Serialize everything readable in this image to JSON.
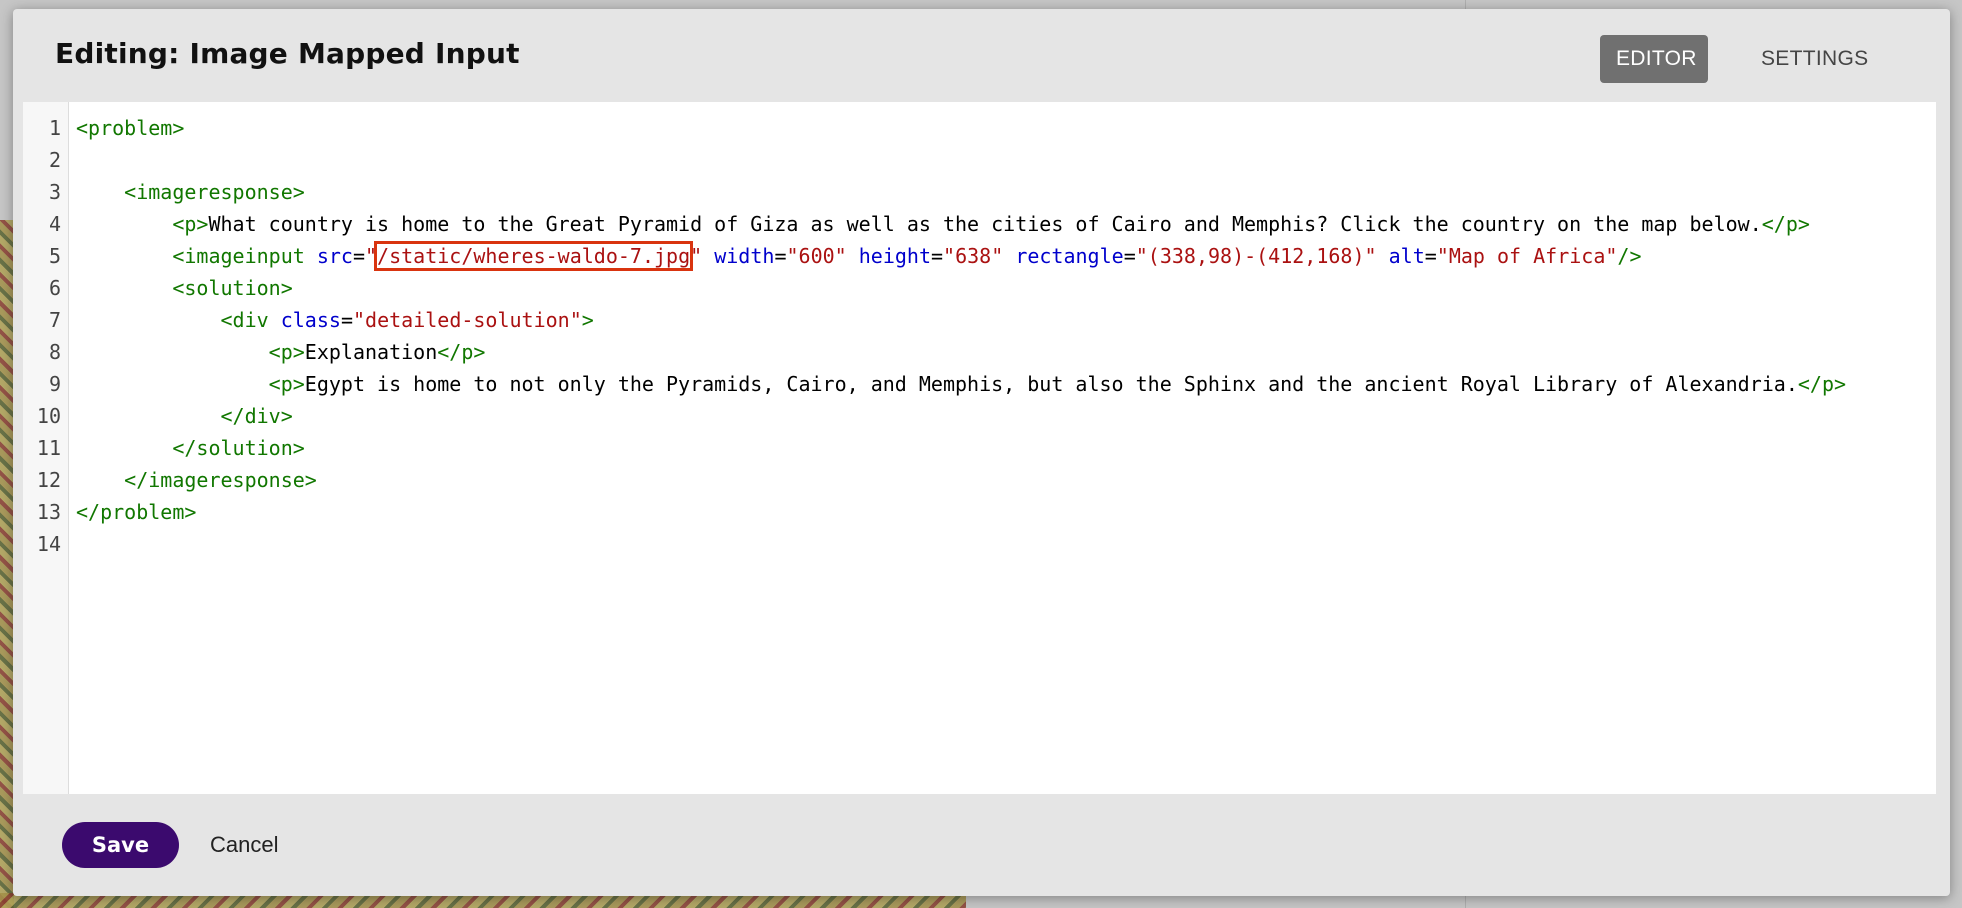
{
  "modal": {
    "title": "Editing: Image Mapped Input",
    "tabs": [
      {
        "label": "EDITOR",
        "active": true
      },
      {
        "label": "SETTINGS",
        "active": false
      }
    ]
  },
  "editor": {
    "highlight_color": "#d9340f",
    "lines": [
      {
        "num": "1",
        "segments": [
          {
            "t": "tag",
            "v": "<problem>"
          }
        ]
      },
      {
        "num": "2",
        "segments": []
      },
      {
        "num": "3",
        "segments": [
          {
            "t": "text",
            "v": "    "
          },
          {
            "t": "tag",
            "v": "<imageresponse>"
          }
        ]
      },
      {
        "num": "4",
        "segments": [
          {
            "t": "text",
            "v": "        "
          },
          {
            "t": "tag",
            "v": "<p>"
          },
          {
            "t": "text",
            "v": "What country is home to the Great Pyramid of Giza as well as the cities of Cairo and Memphis? Click the country on the map below."
          },
          {
            "t": "tag",
            "v": "</p>"
          }
        ]
      },
      {
        "num": "5",
        "segments": [
          {
            "t": "text",
            "v": "        "
          },
          {
            "t": "tag",
            "v": "<imageinput "
          },
          {
            "t": "attr",
            "v": "src"
          },
          {
            "t": "text",
            "v": "="
          },
          {
            "t": "str",
            "v": "\""
          },
          {
            "t": "str_hl",
            "v": "/static/wheres-waldo-7.jpg"
          },
          {
            "t": "str",
            "v": "\""
          },
          {
            "t": "text",
            "v": " "
          },
          {
            "t": "attr",
            "v": "width"
          },
          {
            "t": "text",
            "v": "="
          },
          {
            "t": "str",
            "v": "\"600\""
          },
          {
            "t": "text",
            "v": " "
          },
          {
            "t": "attr",
            "v": "height"
          },
          {
            "t": "text",
            "v": "="
          },
          {
            "t": "str",
            "v": "\"638\""
          },
          {
            "t": "text",
            "v": " "
          },
          {
            "t": "attr",
            "v": "rectangle"
          },
          {
            "t": "text",
            "v": "="
          },
          {
            "t": "str",
            "v": "\"(338,98)-(412,168)\""
          },
          {
            "t": "text",
            "v": " "
          },
          {
            "t": "attr",
            "v": "alt"
          },
          {
            "t": "text",
            "v": "="
          },
          {
            "t": "str",
            "v": "\"Map of Africa\""
          },
          {
            "t": "tag",
            "v": "/>"
          }
        ]
      },
      {
        "num": "6",
        "segments": [
          {
            "t": "text",
            "v": "        "
          },
          {
            "t": "tag",
            "v": "<solution>"
          }
        ]
      },
      {
        "num": "7",
        "segments": [
          {
            "t": "text",
            "v": "            "
          },
          {
            "t": "tag",
            "v": "<div "
          },
          {
            "t": "attr",
            "v": "class"
          },
          {
            "t": "text",
            "v": "="
          },
          {
            "t": "str",
            "v": "\"detailed-solution\""
          },
          {
            "t": "tag",
            "v": ">"
          }
        ]
      },
      {
        "num": "8",
        "segments": [
          {
            "t": "text",
            "v": "                "
          },
          {
            "t": "tag",
            "v": "<p>"
          },
          {
            "t": "text",
            "v": "Explanation"
          },
          {
            "t": "tag",
            "v": "</p>"
          }
        ]
      },
      {
        "num": "9",
        "segments": [
          {
            "t": "text",
            "v": "                "
          },
          {
            "t": "tag",
            "v": "<p>"
          },
          {
            "t": "text",
            "v": "Egypt is home to not only the Pyramids, Cairo, and Memphis, but also the Sphinx and the ancient Royal Library of Alexandria."
          },
          {
            "t": "tag",
            "v": "</p>"
          }
        ]
      },
      {
        "num": "10",
        "segments": [
          {
            "t": "text",
            "v": "            "
          },
          {
            "t": "tag",
            "v": "</div>"
          }
        ]
      },
      {
        "num": "11",
        "segments": [
          {
            "t": "text",
            "v": "        "
          },
          {
            "t": "tag",
            "v": "</solution>"
          }
        ]
      },
      {
        "num": "12",
        "segments": [
          {
            "t": "text",
            "v": "    "
          },
          {
            "t": "tag",
            "v": "</imageresponse>"
          }
        ]
      },
      {
        "num": "13",
        "segments": [
          {
            "t": "tag",
            "v": "</problem>"
          }
        ]
      },
      {
        "num": "14",
        "segments": []
      }
    ]
  },
  "footer": {
    "save_label": "Save",
    "cancel_label": "Cancel"
  }
}
